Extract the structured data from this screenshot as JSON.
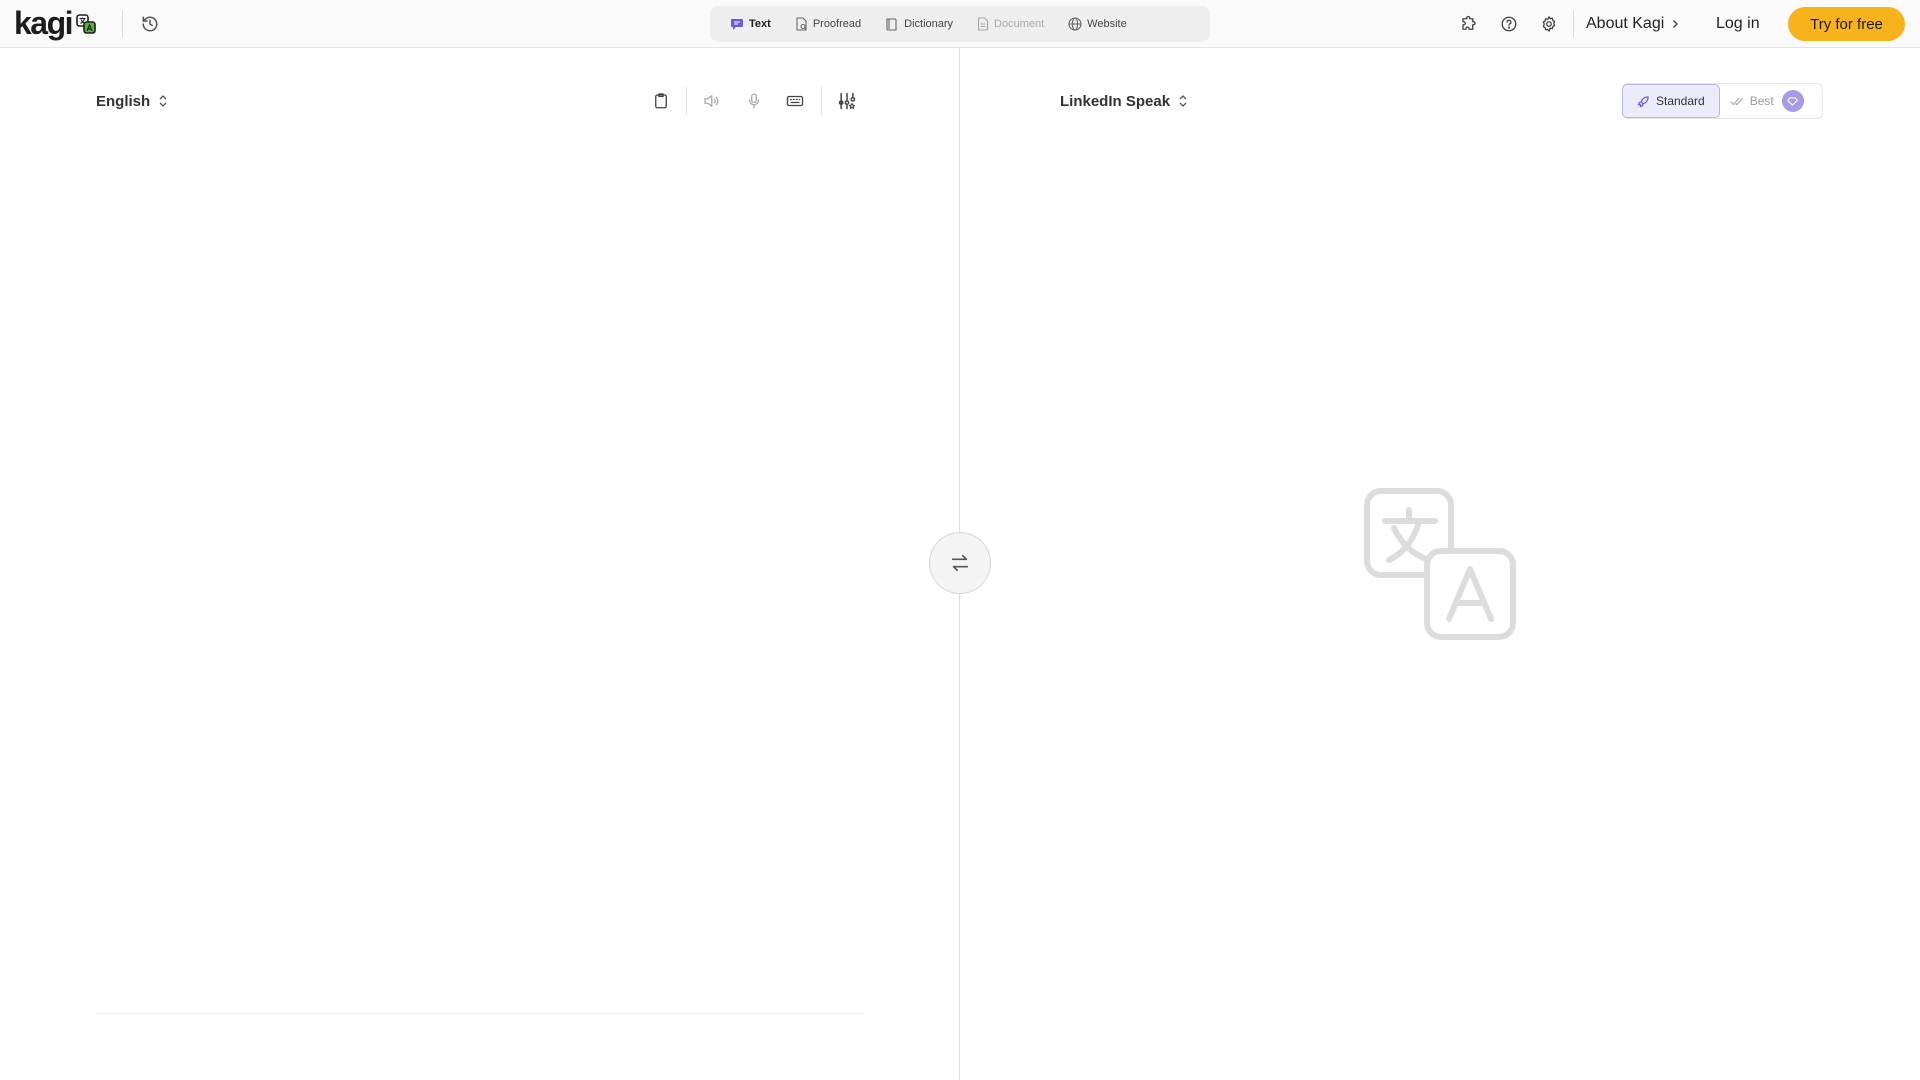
{
  "brand": {
    "logo_text": "kagi"
  },
  "modes": [
    {
      "label": "Text",
      "icon": "chat-bubble-icon",
      "state": "active"
    },
    {
      "label": "Proofread",
      "icon": "document-check-icon",
      "state": "normal"
    },
    {
      "label": "Dictionary",
      "icon": "book-icon",
      "state": "normal"
    },
    {
      "label": "Document",
      "icon": "document-icon",
      "state": "disabled"
    },
    {
      "label": "Website",
      "icon": "globe-icon",
      "state": "normal"
    }
  ],
  "header": {
    "about_label": "About Kagi",
    "login_label": "Log in",
    "try_label": "Try for free",
    "accent_color": "#f8b21c"
  },
  "source": {
    "language": "English",
    "text": ""
  },
  "target": {
    "language": "LinkedIn Speak",
    "quality_options": [
      {
        "label": "Standard",
        "active": true
      },
      {
        "label": "Best",
        "active": false
      }
    ]
  }
}
